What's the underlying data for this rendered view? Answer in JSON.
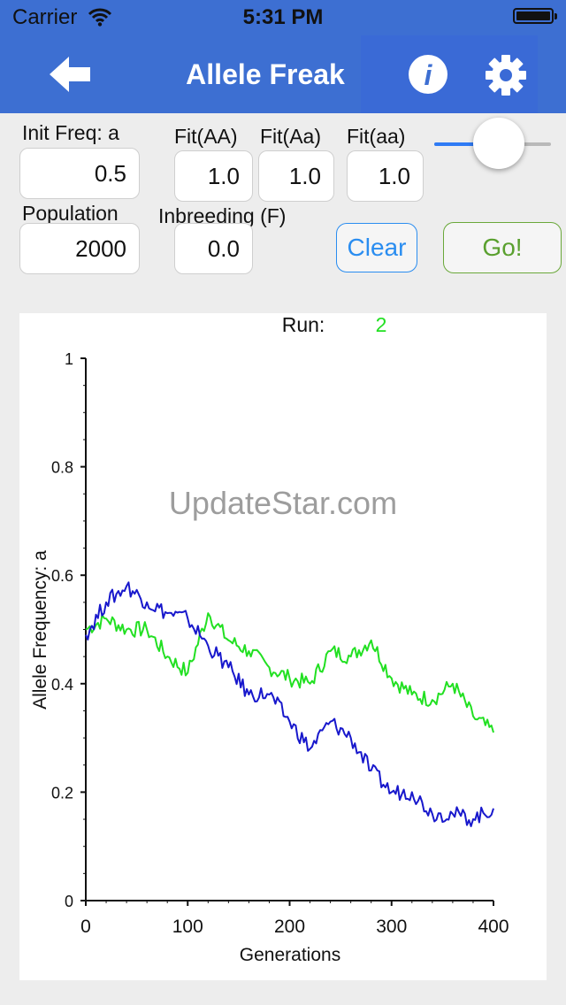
{
  "status_bar": {
    "carrier": "Carrier",
    "time": "5:31 PM"
  },
  "nav": {
    "title": "Allele Freak",
    "back_icon": "back-arrow-icon",
    "info_icon": "info-icon",
    "settings_icon": "gear-icon"
  },
  "colors": {
    "nav_bar": "#3d6fd2",
    "series_green": "#22e022",
    "series_blue": "#1818cc",
    "clear_button": "#2a8df0",
    "go_button": "#5aa02f"
  },
  "form": {
    "init_freq": {
      "label": "Init Freq: a",
      "value": "0.5"
    },
    "fit_AA": {
      "label": "Fit(AA)",
      "value": "1.0"
    },
    "fit_Aa": {
      "label": "Fit(Aa)",
      "value": "1.0"
    },
    "fit_aa": {
      "label": "Fit(aa)",
      "value": "1.0"
    },
    "population": {
      "label": "Population",
      "value": "2000"
    },
    "inbreeding": {
      "label": "Inbreeding (F)",
      "value": "0.0"
    },
    "speed_slider": {
      "value_fraction": 0.4
    },
    "clear_label": "Clear",
    "go_label": "Go!"
  },
  "run": {
    "label": "Run:",
    "value": "2"
  },
  "watermark": "UpdateStar.com",
  "chart_data": {
    "type": "line",
    "xlabel": "Generations",
    "ylabel": "Allele Frequency: a",
    "xlim": [
      0,
      400
    ],
    "ylim": [
      0,
      1
    ],
    "x_ticks": [
      "0",
      "100",
      "200",
      "300",
      "400"
    ],
    "y_ticks": [
      "0",
      "0.2",
      "0.4",
      "0.6",
      "0.8",
      "1"
    ],
    "x": [
      0,
      20,
      40,
      60,
      80,
      100,
      120,
      140,
      160,
      180,
      200,
      220,
      240,
      260,
      280,
      300,
      320,
      340,
      360,
      380,
      400
    ],
    "series": [
      {
        "color": "#22e022",
        "values": [
          0.5,
          0.52,
          0.5,
          0.5,
          0.45,
          0.42,
          0.53,
          0.48,
          0.46,
          0.43,
          0.41,
          0.4,
          0.46,
          0.45,
          0.48,
          0.41,
          0.38,
          0.37,
          0.4,
          0.34,
          0.31
        ]
      },
      {
        "color": "#1818cc",
        "values": [
          0.49,
          0.55,
          0.58,
          0.55,
          0.53,
          0.52,
          0.47,
          0.43,
          0.38,
          0.38,
          0.33,
          0.28,
          0.33,
          0.3,
          0.24,
          0.2,
          0.2,
          0.16,
          0.16,
          0.15,
          0.17
        ]
      }
    ]
  }
}
